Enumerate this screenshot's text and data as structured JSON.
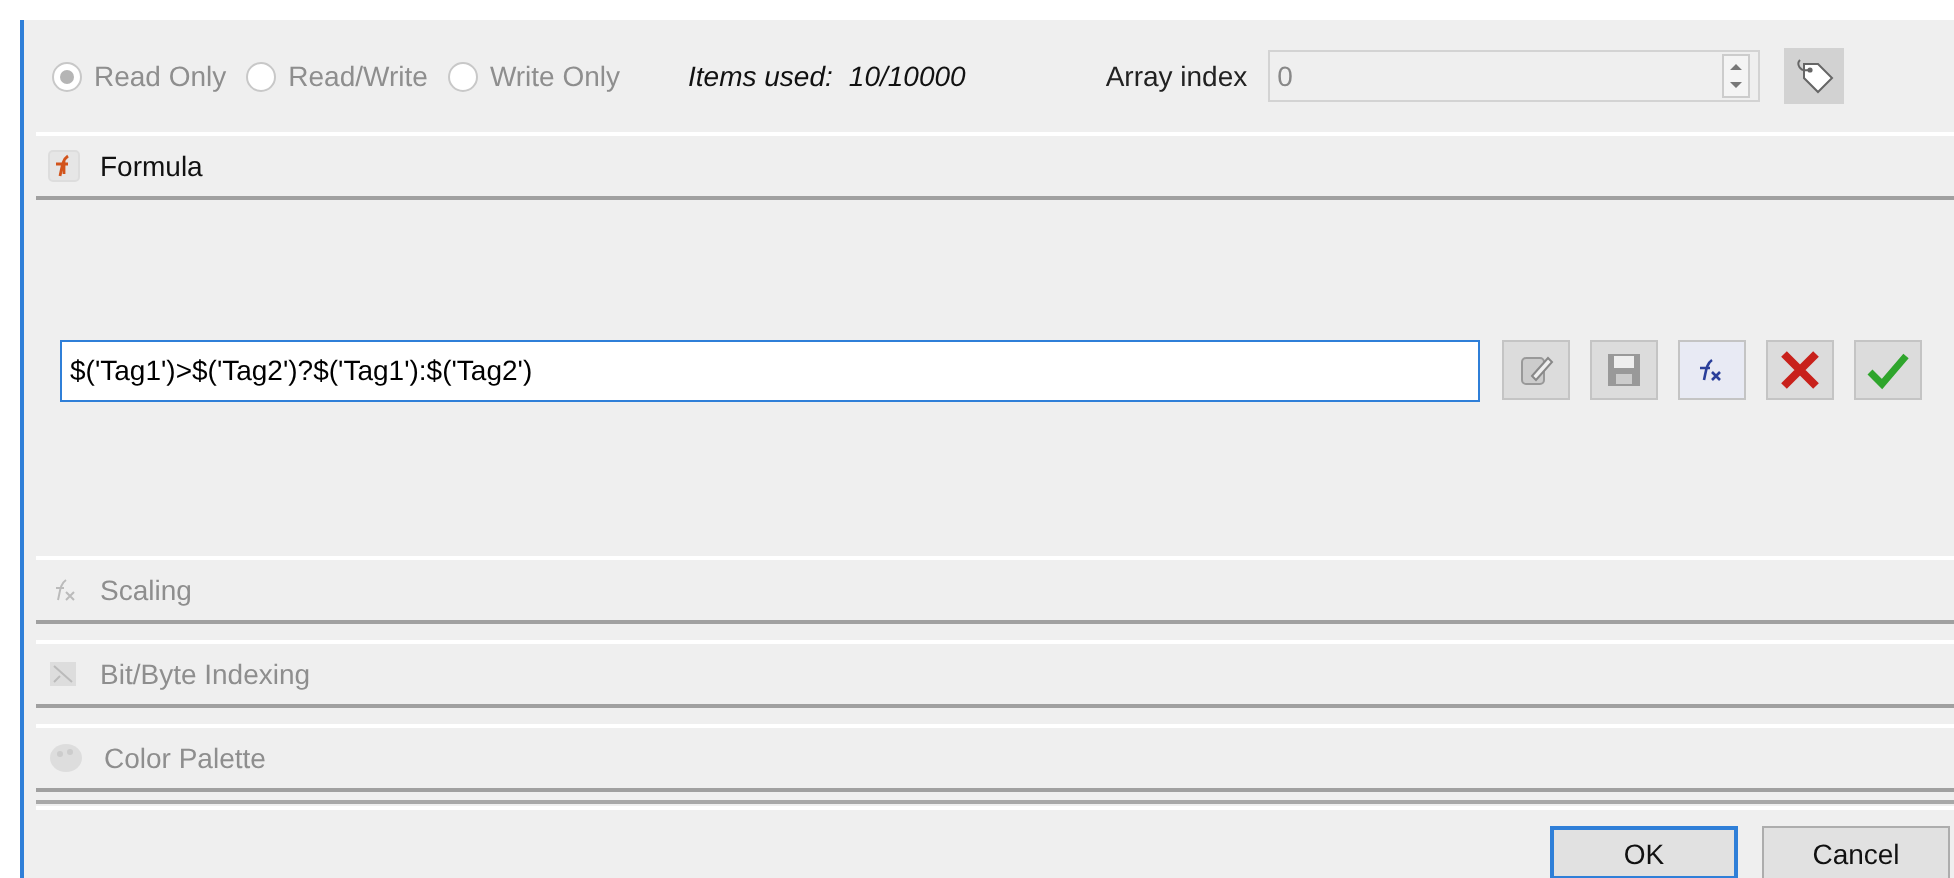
{
  "access_modes": [
    {
      "label": "Read Only",
      "selected": true,
      "disabled": true
    },
    {
      "label": "Read/Write",
      "selected": false,
      "disabled": true
    },
    {
      "label": "Write Only",
      "selected": false,
      "disabled": true
    }
  ],
  "items_used": {
    "label": "Items used:",
    "value": "10/10000"
  },
  "array_index": {
    "label": "Array index",
    "value": "0",
    "disabled": true
  },
  "sections": [
    {
      "kind": "formula",
      "title": "Formula",
      "disabled": false,
      "formula": "$('Tag1')>$('Tag2')?$('Tag1'):$('Tag2')"
    },
    {
      "kind": "scaling",
      "title": "Scaling",
      "disabled": true
    },
    {
      "kind": "bits",
      "title": "Bit/Byte Indexing",
      "disabled": true
    },
    {
      "kind": "palette",
      "title": "Color Palette",
      "disabled": true
    }
  ],
  "buttons": [
    {
      "label": "OK",
      "selected": true
    },
    {
      "label": "Cancel",
      "selected": false
    }
  ]
}
